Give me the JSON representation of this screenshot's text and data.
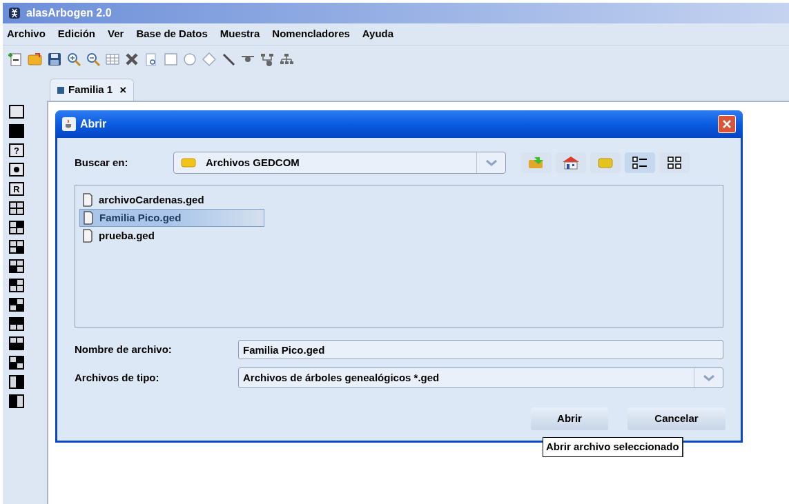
{
  "app": {
    "title": "alasArbogen 2.0"
  },
  "menu": [
    "Archivo",
    "Edición",
    "Ver",
    "Base de Datos",
    "Muestra",
    "Nomencladores",
    "Ayuda"
  ],
  "tabs": [
    {
      "label": "Familia 1",
      "close": "×",
      "selected": true
    }
  ],
  "palette": [
    {
      "kind": "empty"
    },
    {
      "kind": "filled"
    },
    {
      "kind": "char",
      "label": "?"
    },
    {
      "kind": "dot"
    },
    {
      "kind": "char",
      "label": "R"
    },
    {
      "kind": "quad-none"
    },
    {
      "kind": "quad-tr"
    },
    {
      "kind": "quad-br"
    },
    {
      "kind": "quad-bl"
    },
    {
      "kind": "quad-tl"
    },
    {
      "kind": "quad-tl-br"
    },
    {
      "kind": "quad-top"
    },
    {
      "kind": "quad-bottom"
    },
    {
      "kind": "quad-tr-bl"
    },
    {
      "kind": "half-right"
    },
    {
      "kind": "half-left"
    }
  ],
  "dialog": {
    "title": "Abrir",
    "look_in": {
      "label": "Buscar en:",
      "value": "Archivos GEDCOM"
    },
    "nav_buttons": [
      {
        "kind": "up"
      },
      {
        "kind": "home"
      },
      {
        "kind": "new-folder"
      },
      {
        "kind": "list",
        "selected": true
      },
      {
        "kind": "details",
        "selected": false
      }
    ],
    "files": [
      {
        "name": "archivoCardenas.ged",
        "selected": false
      },
      {
        "name": "Familia Pico.ged",
        "selected": true
      },
      {
        "name": "prueba.ged",
        "selected": false
      }
    ],
    "file_name": {
      "label": "Nombre de archivo:",
      "value": "Familia Pico.ged"
    },
    "file_type": {
      "label": "Archivos de tipo:",
      "value": "Archivos de árboles genealógicos *.ged"
    },
    "buttons": [
      "Abrir",
      "Cancelar"
    ]
  },
  "tooltip": "Abrir archivo seleccionado"
}
